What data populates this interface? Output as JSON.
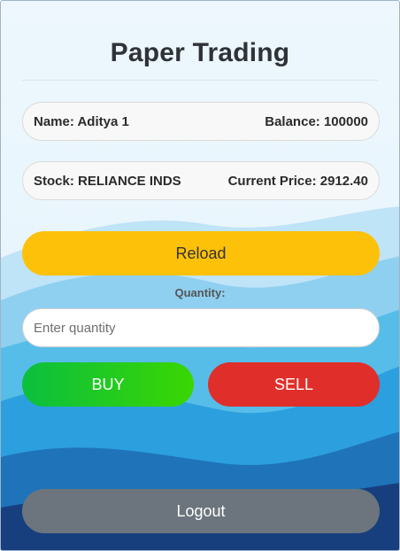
{
  "app": {
    "title": "Paper Trading"
  },
  "user": {
    "name_label": "Name: Aditya 1",
    "balance_label": "Balance: 100000"
  },
  "stock": {
    "name_label": "Stock: RELIANCE INDS",
    "price_label": "Current Price: 2912.40"
  },
  "actions": {
    "reload_label": "Reload",
    "buy_label": "BUY",
    "sell_label": "SELL",
    "logout_label": "Logout"
  },
  "quantity": {
    "label": "Quantity:",
    "placeholder": "Enter quantity",
    "value": ""
  },
  "colors": {
    "reload": "#fdc10a",
    "buy_start": "#0bbf3f",
    "buy_end": "#3ad602",
    "sell": "#e02f2b",
    "logout": "#6c757d"
  }
}
